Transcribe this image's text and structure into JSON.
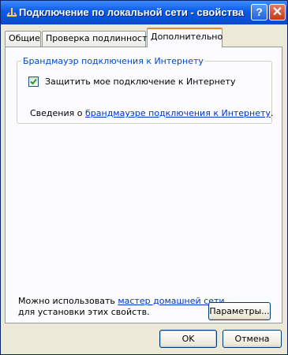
{
  "window": {
    "title": "Подключение по локальной сети - свойства",
    "help_label": "?",
    "close_label": "✕"
  },
  "tabs": [
    {
      "label": "Общие"
    },
    {
      "label": "Проверка подлинности"
    },
    {
      "label": "Дополнительно",
      "active": true
    }
  ],
  "firewall": {
    "group_label": "Брандмауэр подключения к Интернету",
    "checkbox_label": "Защитить мое подключение к Интернету",
    "checked": true,
    "info_prefix": "Сведения о ",
    "info_link": "брандмауэре подключения к Интернету",
    "info_suffix": "."
  },
  "home_network": {
    "line1_prefix": "Можно использовать ",
    "line1_link": "мастер домашней сети",
    "line2": "для установки этих свойств.",
    "params_button": "Параметры..."
  },
  "footer": {
    "ok_label": "OK",
    "cancel_label": "Отмена"
  },
  "colors": {
    "titlebar": "#0a5ae6",
    "link": "#0033cc",
    "checkmark": "#21a121"
  }
}
